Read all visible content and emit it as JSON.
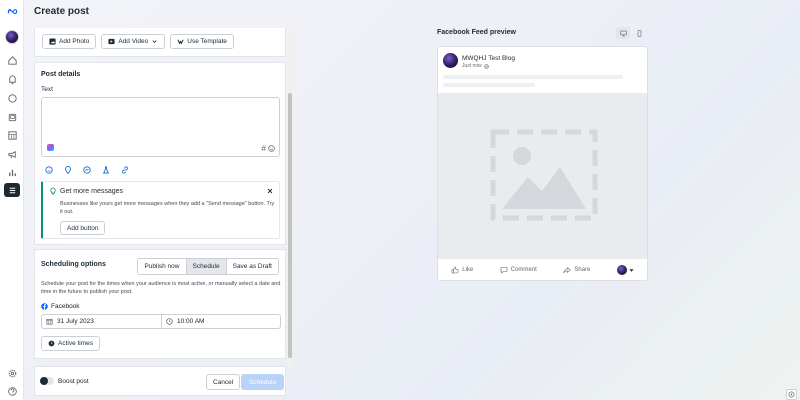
{
  "page": {
    "title": "Create post"
  },
  "media_buttons": {
    "add_photo": "Add Photo",
    "add_video": "Add Video",
    "use_template": "Use Template"
  },
  "post_details": {
    "title": "Post details",
    "text_label": "Text"
  },
  "tip": {
    "title": "Get more messages",
    "body": "Businesses like yours get more messages when they add a \"Send message\" button. Try it out.",
    "button": "Add button"
  },
  "scheduling": {
    "title": "Scheduling options",
    "options": [
      "Publish now",
      "Schedule",
      "Save as Draft"
    ],
    "selected": "Schedule",
    "description": "Schedule your post for the times when your audience is most active, or manually select a date and time in the future to publish your post.",
    "platform": "Facebook",
    "date": "31 July 2023",
    "time": "10:00 AM",
    "active_times": "Active times"
  },
  "footer": {
    "boost_label": "Boost post",
    "cancel": "Cancel",
    "schedule": "Schedule"
  },
  "preview": {
    "title": "Facebook Feed preview",
    "page_name": "MWQHJ Test Blog",
    "timestamp": "Just now",
    "actions": {
      "like": "Like",
      "comment": "Comment",
      "share": "Share"
    }
  },
  "colors": {
    "accent": "#0866ff",
    "brand_dark": "#1c2b33",
    "tip_border": "#0a8f79",
    "disabled_button": "#b9d3f8"
  }
}
